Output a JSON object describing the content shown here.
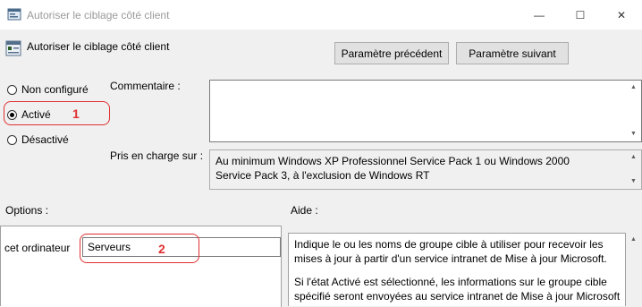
{
  "window": {
    "title": "Autoriser le ciblage côté client",
    "minimize_glyph": "—",
    "maximize_glyph": "☐",
    "close_glyph": "✕"
  },
  "header": {
    "title": "Autoriser le ciblage côté client",
    "icon": "policy-setting-icon"
  },
  "nav": {
    "prev_label": "Paramètre précédent",
    "next_label": "Paramètre suivant"
  },
  "state": {
    "options": [
      {
        "label": "Non configuré",
        "checked": false
      },
      {
        "label": "Activé",
        "checked": true
      },
      {
        "label": "Désactivé",
        "checked": false
      }
    ]
  },
  "comment": {
    "label": "Commentaire :",
    "value": ""
  },
  "supported": {
    "label": "Pris en charge sur :",
    "value": "Au minimum Windows XP Professionnel Service Pack 1 ou Windows 2000 Service Pack 3, à l'exclusion de Windows RT"
  },
  "options": {
    "label": "Options :",
    "computer_label": "cet ordinateur",
    "server_value": "Serveurs"
  },
  "help": {
    "label": "Aide :",
    "paragraphs": [
      "Indique le ou les noms de groupe cible à utiliser pour recevoir les mises à jour à partir d'un service intranet de Mise à jour Microsoft.",
      "Si l'état Activé est sélectionné, les informations sur le groupe cible spécifié seront envoyées au service intranet de Mise à jour Microsoft"
    ]
  },
  "annotations": {
    "one": "1",
    "two": "2",
    "color": "#e03030"
  }
}
